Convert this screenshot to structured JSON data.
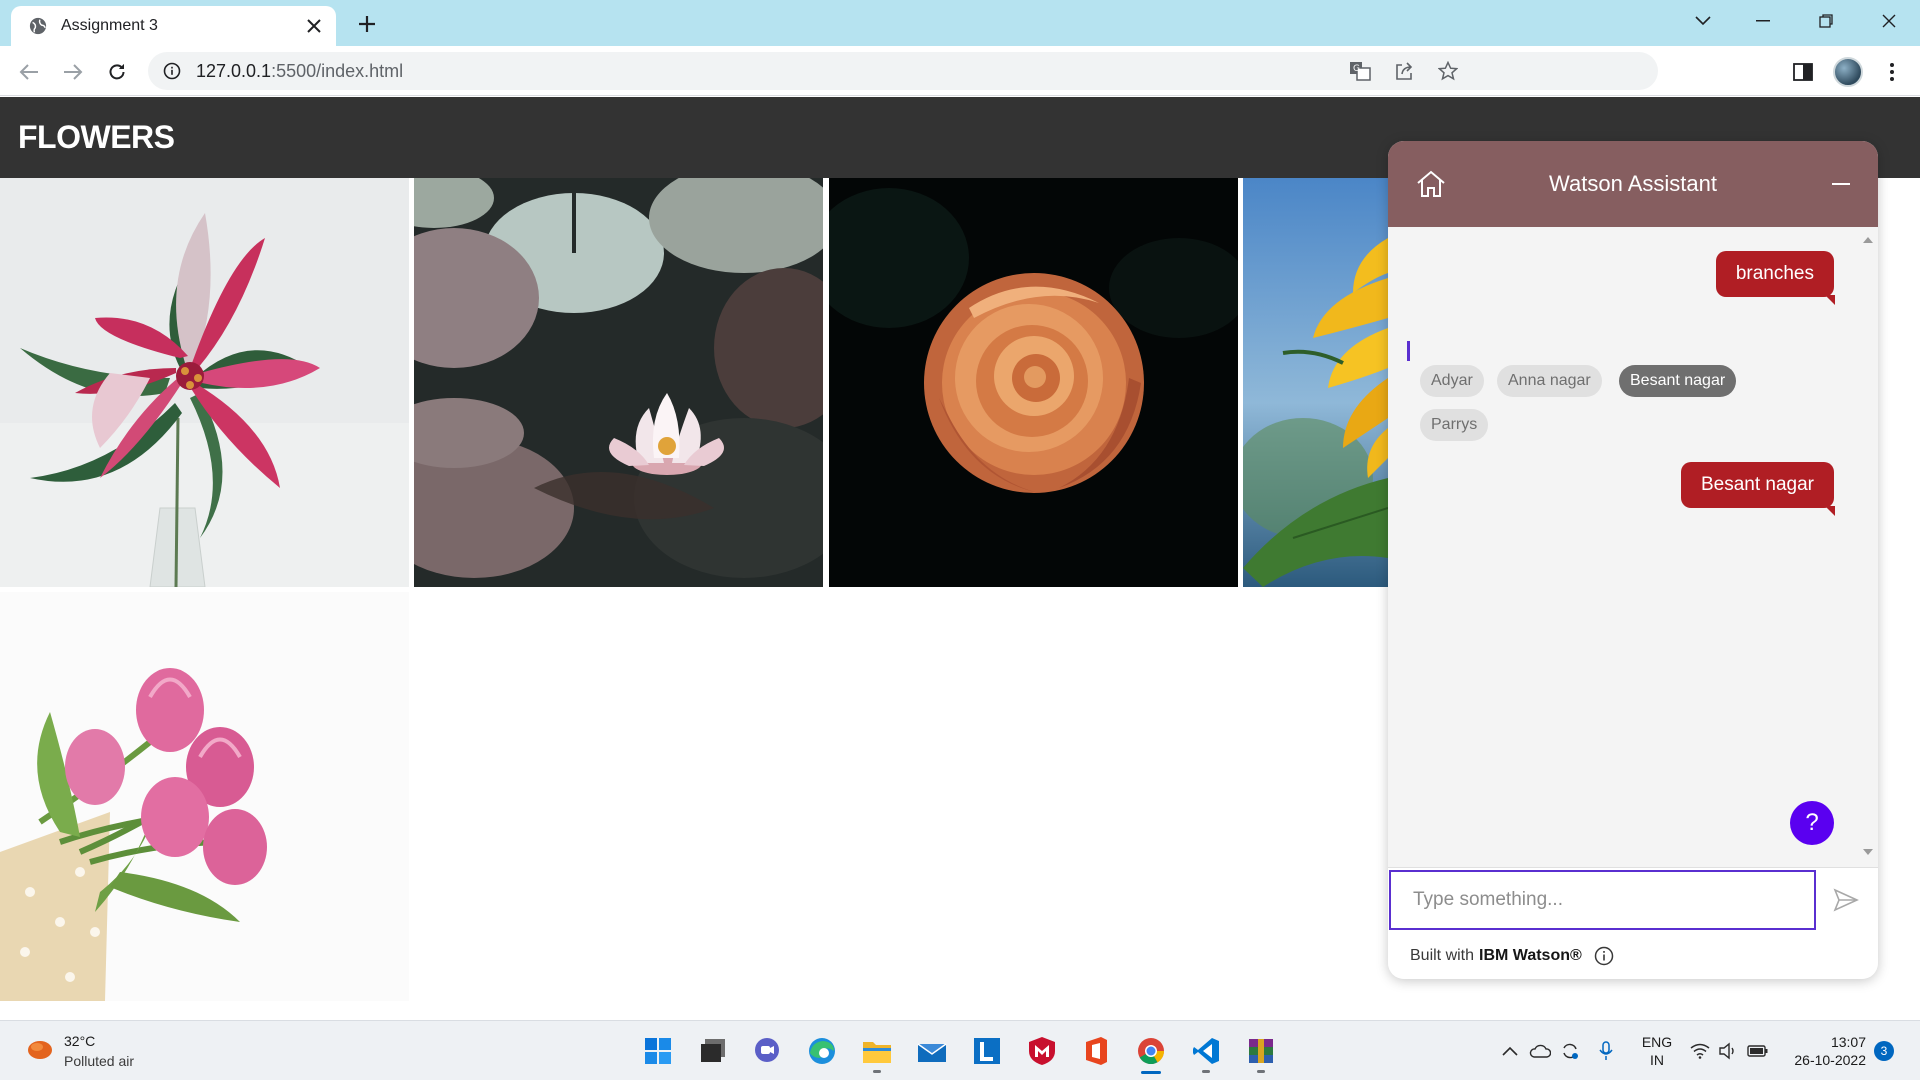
{
  "browser": {
    "tab_title": "Assignment 3",
    "url_host": "127.0.0.1",
    "url_rest": ":5500/index.html"
  },
  "page": {
    "title": "FLOWERS",
    "photos": [
      "pink-lily-photo",
      "water-lily-photo",
      "orange-rose-photo",
      "sunflower-photo",
      "pink-tulips-photo"
    ]
  },
  "chat": {
    "title": "Watson Assistant",
    "messages": [
      {
        "from": "user",
        "text": "branches"
      },
      {
        "from": "user",
        "text": "Besant nagar"
      }
    ],
    "options": [
      "Adyar",
      "Anna nagar",
      "Besant nagar",
      "Parrys"
    ],
    "selected_option": "Besant nagar",
    "input_placeholder": "Type something...",
    "help_label": "?",
    "footer_prefix": "Built with",
    "footer_brand": "IBM Watson®",
    "colors": {
      "header": "#865e60",
      "user_bubble": "#b01e24",
      "accent": "#5a00f0"
    }
  },
  "taskbar": {
    "temperature": "32°C",
    "weather": "Polluted air",
    "language_1": "ENG",
    "language_2": "IN",
    "time": "13:07",
    "date": "26-10-2022",
    "notification_count": "3",
    "apps": [
      "windows-start",
      "file-explorer-dark",
      "teams-chat",
      "edge",
      "file-explorer",
      "mail",
      "l-app",
      "mcafee",
      "office",
      "chrome",
      "vscode",
      "winrar"
    ]
  }
}
